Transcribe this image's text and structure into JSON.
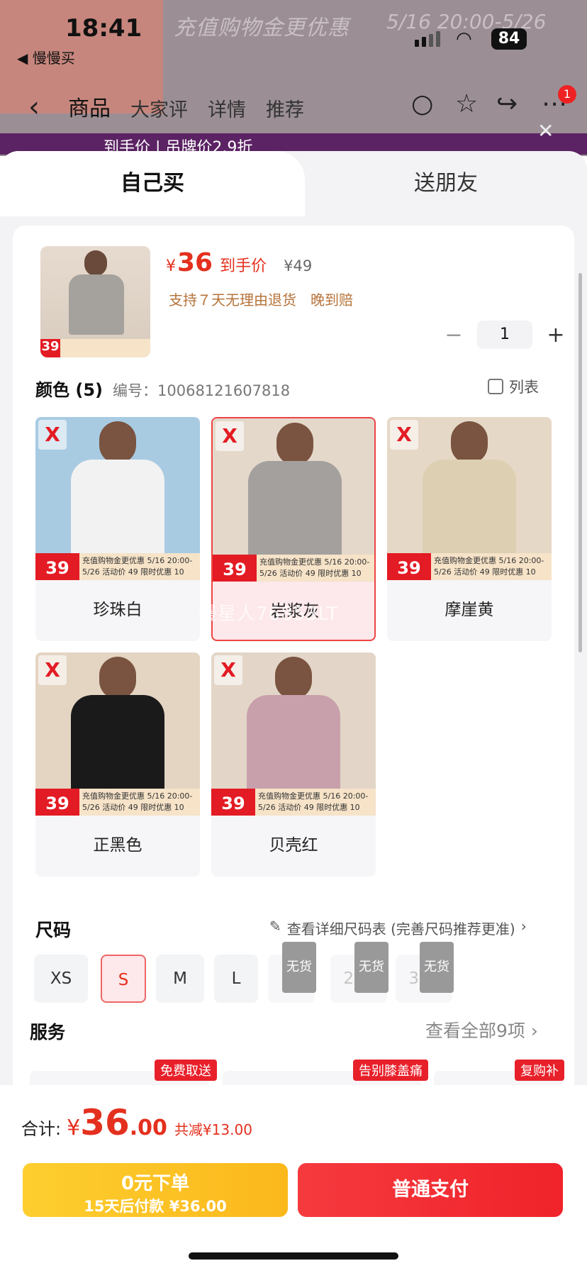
{
  "status_bar": {
    "time": "18:41",
    "back_app": "◀ 慢慢买",
    "battery": "84"
  },
  "bg": {
    "promo_left": "充值购物金更优惠",
    "promo_right": "5/16 20:00-5/26",
    "sub_left": "活动价",
    "sub_right": "限时优惠",
    "band_text": "到手价 | 吊牌价2.9折",
    "cart_badge": "1"
  },
  "nav": {
    "tabs": [
      "商品",
      "大家评",
      "详情",
      "推荐"
    ]
  },
  "segment": {
    "left": "自己买",
    "right": "送朋友"
  },
  "product": {
    "price_symbol": "¥",
    "price": "36",
    "price_tag": "到手价",
    "orig_price": "¥49",
    "policy": [
      "支持７天无理由退货",
      "晚到赔"
    ],
    "quantity": "1",
    "thumb_price": "39"
  },
  "color": {
    "title": "颜色 (5)",
    "sku": "编号：10068121607818",
    "list_label": "列表",
    "items": [
      {
        "name": "珍珠白",
        "price": "39",
        "shirt": "#f2f2f2",
        "bg": "#a8cbe2",
        "selected": false
      },
      {
        "name": "岩浆灰",
        "price": "39",
        "shirt": "#a3a09d",
        "bg": "#e4d8ca",
        "selected": true
      },
      {
        "name": "摩崖黄",
        "price": "39",
        "shirt": "#ddcfb2",
        "bg": "#e6d8c6",
        "selected": false
      },
      {
        "name": "正黑色",
        "price": "39",
        "shirt": "#1a1a1a",
        "bg": "#e4d4c2",
        "selected": false
      },
      {
        "name": "贝壳红",
        "price": "39",
        "shirt": "#c8a0ac",
        "bg": "#e3d6c8",
        "selected": false
      }
    ],
    "strip_text": "充值购物金更优惠 5/16 20:00-5/26 活动价 49 限时优惠 10"
  },
  "watermark": "慢星人76853LT",
  "size": {
    "title": "尺码",
    "link": "查看详细尺码表 (完善尺码推荐更准)",
    "items": [
      {
        "label": "XS",
        "state": "normal"
      },
      {
        "label": "S",
        "state": "selected"
      },
      {
        "label": "M",
        "state": "normal"
      },
      {
        "label": "L",
        "state": "normal"
      },
      {
        "label": "XL",
        "state": "disabled"
      },
      {
        "label": "2XL",
        "state": "disabled"
      },
      {
        "label": "3XL",
        "state": "disabled"
      }
    ],
    "oos_label": "无货"
  },
  "service": {
    "title": "服务",
    "all": "查看全部9项",
    "tags": [
      "免费取送",
      "告别膝盖痛",
      "复购补"
    ]
  },
  "footer": {
    "total_label": "合计:",
    "symbol": "¥",
    "total_int": "36",
    "total_dec": ".00",
    "saving": "共减¥13.00",
    "pay_later_line1": "0元下单",
    "pay_later_line2": "15天后付款 ¥36.00",
    "pay": "普通支付"
  }
}
